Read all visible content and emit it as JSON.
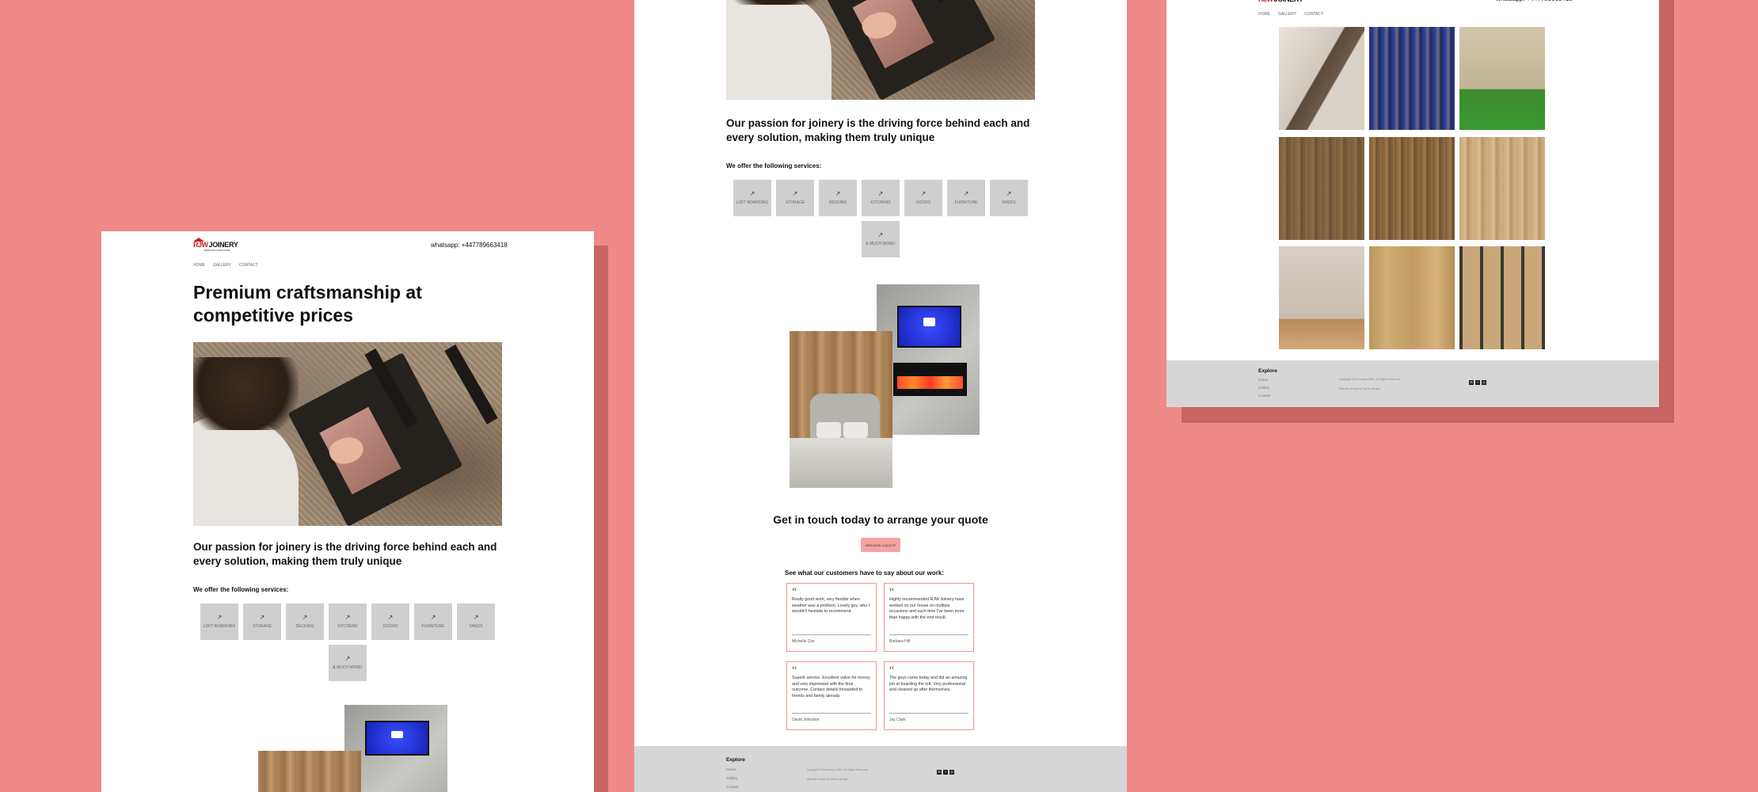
{
  "header": {
    "logo_red": "RJW",
    "logo_black": "JOINERY",
    "logo_sub": "BESPOKE FURNITURE",
    "whatsapp": "whatsapp: +447789663418",
    "nav": [
      "HOME",
      "GALLERY",
      "CONTACT"
    ]
  },
  "hero": {
    "title": "Premium craftsmanship at competitive prices",
    "subtitle": "Our passion for joinery is the driving force behind each and every solution, making them truly unique"
  },
  "services": {
    "heading": "We offer the following services:",
    "icon": "↗",
    "items": [
      "LOFT BOARDING",
      "STORAGE",
      "DECKING",
      "KITCHENS",
      "DOORS",
      "FURNITURE",
      "SHEDS",
      "& MUCH MORE!"
    ]
  },
  "contact": {
    "heading": "Get in touch today to arrange your quote",
    "button": "ARRANGE A QUOTE"
  },
  "testimonials": {
    "heading": "See what our customers have to say about our work:",
    "quote_mark": "“",
    "items": [
      {
        "text": "Really good work, very flexible when weather was a problem. Lovely guy, who I wouldn't hesitate to recommend",
        "name": "Michelle Cox"
      },
      {
        "text": "Highly recommended RJW Joinery have worked on our house on multiple occasions and each time I've been more than happy with the end result.",
        "name": "Barbara Hill"
      },
      {
        "text": "Superb service. Excellent value for money and very impressed with the final outcome. Contact details forwarded to friends and family already.",
        "name": "David Johnston"
      },
      {
        "text": "The guys came today and did an amazing job at boarding the loft. Very professional and cleaned up after themselves.",
        "name": "Jay Clark"
      }
    ]
  },
  "footer": {
    "explore": "Explore",
    "links": [
      "Home",
      "Gallery",
      "Contact"
    ],
    "copyright": "Copyright RJW Joinery 2021, All Rights Reserved",
    "designer": "Website design by Sherry Weiger",
    "social_icons": [
      "email-icon",
      "facebook-icon",
      "instagram-icon"
    ]
  },
  "colors": {
    "background": "#f08a88",
    "accent": "#f4a3a3",
    "card_border": "#f39494",
    "service_tile": "#cfcfcf",
    "footer": "#d6d6d6"
  }
}
